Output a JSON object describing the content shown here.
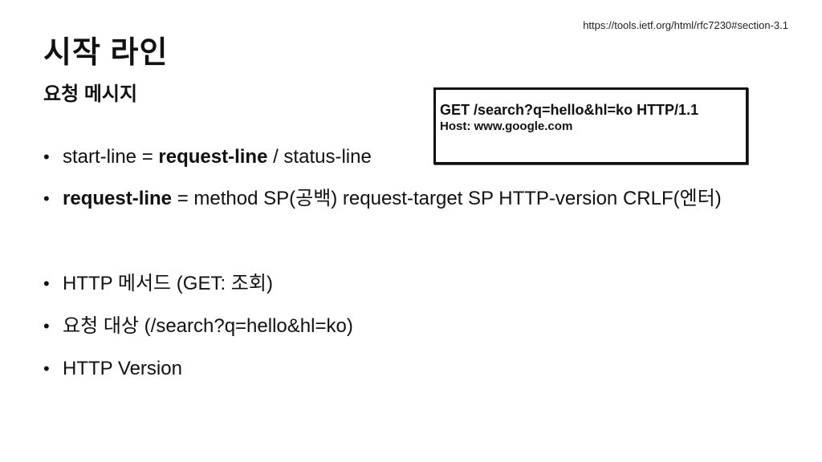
{
  "reference_url": "https://tools.ietf.org/html/rfc7230#section-3.1",
  "title": "시작 라인",
  "subtitle": "요청 메시지",
  "example": {
    "line1": "GET /search?q=hello&hl=ko HTTP/1.1",
    "line2": "Host: www.google.com"
  },
  "bullet_glyph": "•",
  "bullets": [
    {
      "pre": "start-line = ",
      "bold": "request-line",
      "post": " / status-line"
    },
    {
      "bold": "request-line",
      "post": " = method SP(공백) request-target SP HTTP-version CRLF(엔터)"
    },
    {
      "text": "HTTP 메서드 (GET: 조회)"
    },
    {
      "text": "요청 대상 (/search?q=hello&hl=ko)"
    },
    {
      "text": "HTTP Version"
    }
  ]
}
